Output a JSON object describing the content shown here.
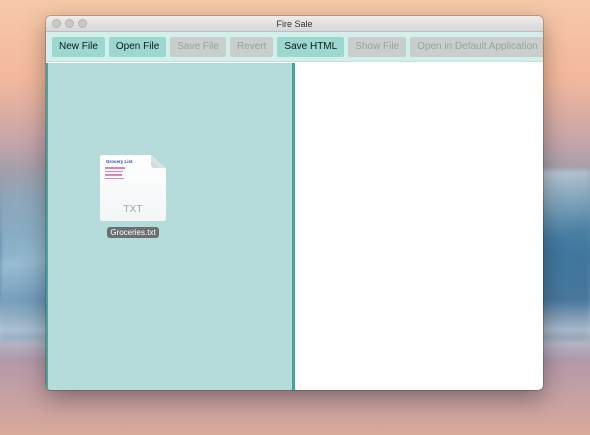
{
  "window": {
    "title": "Fire Sale"
  },
  "toolbar": {
    "new_file": "New File",
    "open_file": "Open File",
    "save_file": "Save File",
    "revert": "Revert",
    "save_html": "Save HTML",
    "show_file": "Show File",
    "open_default": "Open in Default Application"
  },
  "desktop_file": {
    "name": "Groceries.txt",
    "extension": "TXT",
    "icon": "text-document-icon",
    "preview_title": "Grocery List"
  },
  "colors": {
    "toolbar_bg": "#d3efec",
    "button_bg": "#9cd7d0",
    "button_disabled_bg": "#c8cfcd",
    "editor_bg": "#b5dcdb",
    "editor_border": "#4aa39a",
    "preview_bg": "#ffffff"
  }
}
